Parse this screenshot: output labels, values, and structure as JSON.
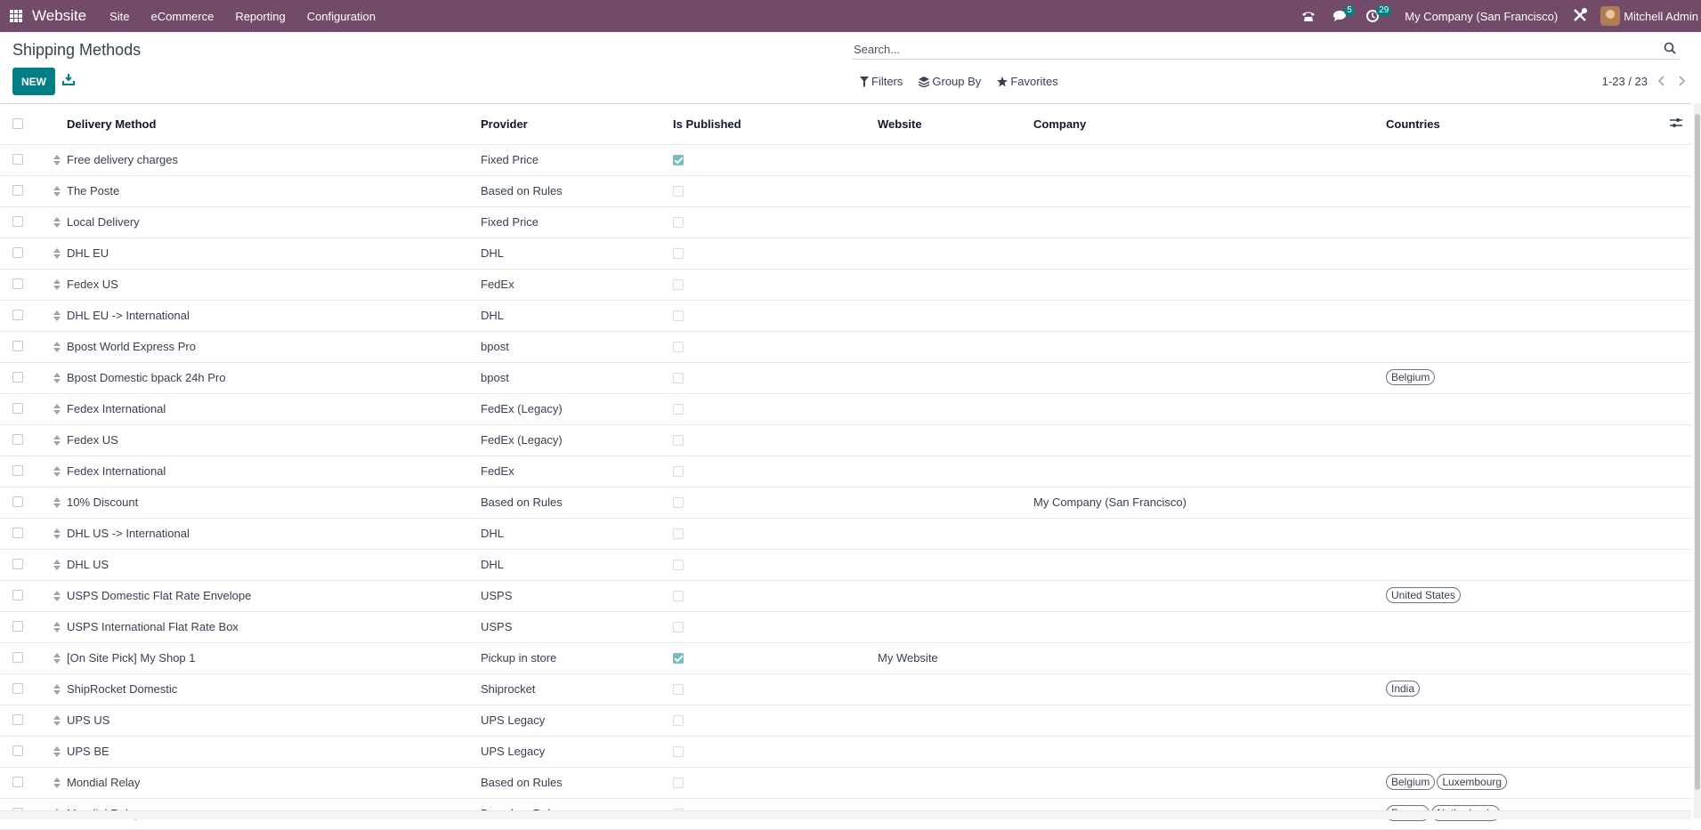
{
  "navbar": {
    "app_name": "Website",
    "menus": [
      "Site",
      "eCommerce",
      "Reporting",
      "Configuration"
    ],
    "messages_count": "5",
    "activities_count": "29",
    "company": "My Company (San Francisco)",
    "user": "Mitchell Admin",
    "color": "#714B67"
  },
  "page": {
    "title": "Shipping Methods",
    "new_label": "NEW"
  },
  "search": {
    "placeholder": "Search..."
  },
  "filters": {
    "filters_label": "Filters",
    "group_by_label": "Group By",
    "favorites_label": "Favorites"
  },
  "pager": {
    "text": "1-23 / 23"
  },
  "list": {
    "columns": [
      "Delivery Method",
      "Provider",
      "Is Published",
      "Website",
      "Company",
      "Countries"
    ],
    "rows": [
      {
        "name": "Free delivery charges",
        "provider": "Fixed Price",
        "published": true,
        "website": "",
        "company": "",
        "countries": []
      },
      {
        "name": "The Poste",
        "provider": "Based on Rules",
        "published": false,
        "website": "",
        "company": "",
        "countries": []
      },
      {
        "name": "Local Delivery",
        "provider": "Fixed Price",
        "published": false,
        "website": "",
        "company": "",
        "countries": []
      },
      {
        "name": "DHL EU",
        "provider": "DHL",
        "published": false,
        "website": "",
        "company": "",
        "countries": []
      },
      {
        "name": "Fedex US",
        "provider": "FedEx",
        "published": false,
        "website": "",
        "company": "",
        "countries": []
      },
      {
        "name": "DHL EU -> International",
        "provider": "DHL",
        "published": false,
        "website": "",
        "company": "",
        "countries": []
      },
      {
        "name": "Bpost World Express Pro",
        "provider": "bpost",
        "published": false,
        "website": "",
        "company": "",
        "countries": []
      },
      {
        "name": "Bpost Domestic bpack 24h Pro",
        "provider": "bpost",
        "published": false,
        "website": "",
        "company": "",
        "countries": [
          "Belgium"
        ]
      },
      {
        "name": "Fedex International",
        "provider": "FedEx (Legacy)",
        "published": false,
        "website": "",
        "company": "",
        "countries": []
      },
      {
        "name": "Fedex US",
        "provider": "FedEx (Legacy)",
        "published": false,
        "website": "",
        "company": "",
        "countries": []
      },
      {
        "name": "Fedex International",
        "provider": "FedEx",
        "published": false,
        "website": "",
        "company": "",
        "countries": []
      },
      {
        "name": "10% Discount",
        "provider": "Based on Rules",
        "published": false,
        "website": "",
        "company": "My Company (San Francisco)",
        "countries": []
      },
      {
        "name": "DHL US -> International",
        "provider": "DHL",
        "published": false,
        "website": "",
        "company": "",
        "countries": []
      },
      {
        "name": "DHL US",
        "provider": "DHL",
        "published": false,
        "website": "",
        "company": "",
        "countries": []
      },
      {
        "name": "USPS Domestic Flat Rate Envelope",
        "provider": "USPS",
        "published": false,
        "website": "",
        "company": "",
        "countries": [
          "United States"
        ]
      },
      {
        "name": "USPS International Flat Rate Box",
        "provider": "USPS",
        "published": false,
        "website": "",
        "company": "",
        "countries": []
      },
      {
        "name": "[On Site Pick] My Shop 1",
        "provider": "Pickup in store",
        "published": true,
        "website": "My Website",
        "company": "",
        "countries": []
      },
      {
        "name": "ShipRocket Domestic",
        "provider": "Shiprocket",
        "published": false,
        "website": "",
        "company": "",
        "countries": [
          "India"
        ]
      },
      {
        "name": "UPS US",
        "provider": "UPS Legacy",
        "published": false,
        "website": "",
        "company": "",
        "countries": []
      },
      {
        "name": "UPS BE",
        "provider": "UPS Legacy",
        "published": false,
        "website": "",
        "company": "",
        "countries": []
      },
      {
        "name": "Mondial Relay",
        "provider": "Based on Rules",
        "published": false,
        "website": "",
        "company": "",
        "countries": [
          "Belgium",
          "Luxembourg"
        ]
      },
      {
        "name": "Mondial Relay",
        "provider": "Based on Rules",
        "published": false,
        "website": "",
        "company": "",
        "countries": [
          "France",
          "Netherlands"
        ]
      }
    ]
  }
}
